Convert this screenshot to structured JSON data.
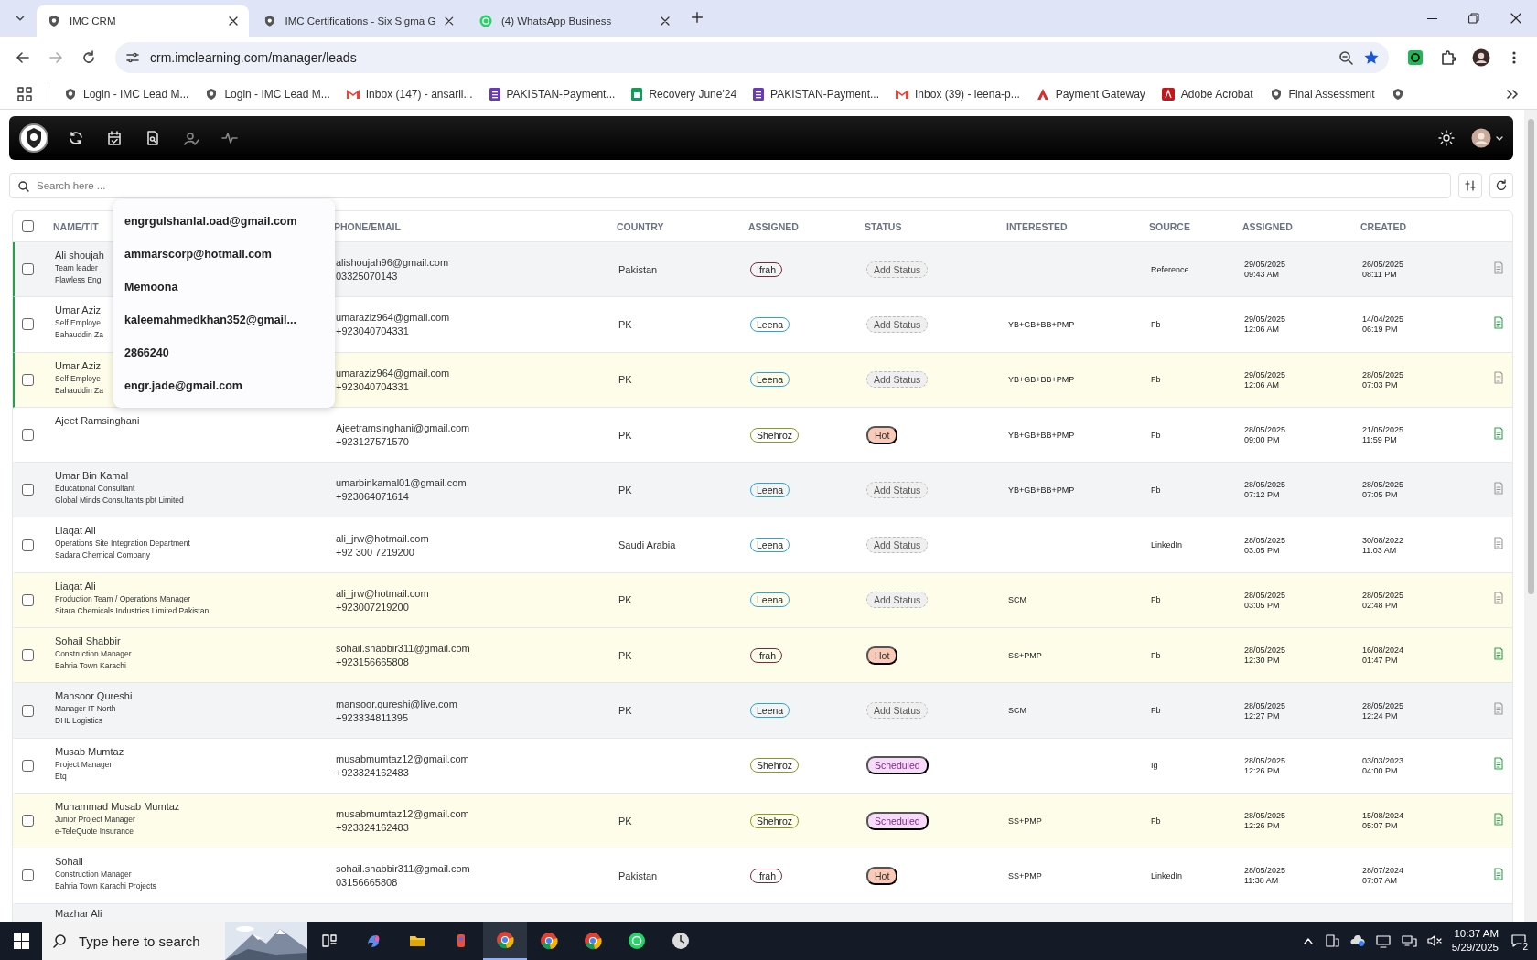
{
  "browser": {
    "tabs": [
      {
        "title": "IMC CRM",
        "kind": "imc",
        "selected": true
      },
      {
        "title": "IMC Certifications - Six Sigma G",
        "kind": "imc",
        "selected": false
      },
      {
        "title": "(4) WhatsApp Business",
        "kind": "whatsapp",
        "selected": false
      }
    ],
    "url": "crm.imclearning.com/manager/leads",
    "bookmarks": [
      {
        "label": "Login - IMC Lead M...",
        "kind": "imc"
      },
      {
        "label": "Login - IMC Lead M...",
        "kind": "imc"
      },
      {
        "label": "Inbox (147) - ansaril...",
        "kind": "gmail"
      },
      {
        "label": "PAKISTAN-Payment...",
        "kind": "form"
      },
      {
        "label": "Recovery June'24",
        "kind": "sheet"
      },
      {
        "label": "PAKISTAN-Payment...",
        "kind": "form"
      },
      {
        "label": "Inbox (39) - leena-p...",
        "kind": "gmail"
      },
      {
        "label": "Payment Gateway",
        "kind": "gateway"
      },
      {
        "label": "Adobe Acrobat",
        "kind": "acrobat"
      },
      {
        "label": "Final Assessment",
        "kind": "imc"
      },
      {
        "kind": "imc"
      }
    ]
  },
  "search": {
    "placeholder": "Search here ..."
  },
  "suggestions": [
    "engrgulshanlal.oad@gmail.com",
    "ammarscorp@hotmail.com",
    "Memoona",
    "kaleemahmedkhan352@gmail...",
    "2866240",
    "engr.jade@gmail.com"
  ],
  "table": {
    "select_all": {
      "checked": false
    },
    "columns": [
      "NAME/TIT",
      "PHONE/EMAIL",
      "COUNTRY",
      "ASSIGNED",
      "STATUS",
      "INTERESTED",
      "SOURCE",
      "ASSIGNED",
      "CREATED"
    ],
    "rows": [
      {
        "checked": false,
        "name": "Ali shoujah",
        "title": "Team leader",
        "company": "Flawless Engi",
        "email": "alishoujah96@gmail.com",
        "phone": "03325070143",
        "country": "Pakistan",
        "assignee": {
          "name": "Ifrah",
          "color": "#7a2a3a"
        },
        "status": {
          "kind": "empty",
          "label": "Add Status"
        },
        "source": "Reference",
        "assigned_date": "29/05/2025",
        "assigned_time": "09:43 AM",
        "created_date": "26/05/2025",
        "created_time": "08:11 PM",
        "color": "#f3f4f6",
        "flagged": true,
        "has_notes": false
      },
      {
        "checked": false,
        "name": "Umar Aziz",
        "title": "Self Employe",
        "company": "Bahauddin Za",
        "email": "umaraziz964@gmail.com",
        "phone": "+923040704331",
        "country": "PK",
        "assignee": {
          "name": "Leena",
          "color": "#2aa6d6"
        },
        "status": {
          "kind": "empty",
          "label": "Add Status"
        },
        "interested": "YB+GB+BB+PMP",
        "source": "Fb",
        "assigned_date": "29/05/2025",
        "assigned_time": "12:06 AM",
        "created_date": "14/04/2025",
        "created_time": "06:19 PM",
        "color": "#ffffff",
        "flagged": true,
        "has_notes": true
      },
      {
        "checked": false,
        "name": "Umar Aziz",
        "title": "Self Employe",
        "company": "Bahauddin Za",
        "email": "umaraziz964@gmail.com",
        "phone": "+923040704331",
        "country": "PK",
        "assignee": {
          "name": "Leena",
          "color": "#2aa6d6"
        },
        "status": {
          "kind": "empty",
          "label": "Add Status"
        },
        "interested": "YB+GB+BB+PMP",
        "source": "Fb",
        "assigned_date": "29/05/2025",
        "assigned_time": "12:06 AM",
        "created_date": "28/05/2025",
        "created_time": "07:03 PM",
        "color": "#fdfde9",
        "flagged": true,
        "has_notes": false
      },
      {
        "checked": false,
        "name": "Ajeet Ramsinghani",
        "email": "Ajeetramsinghani@gmail.com",
        "phone": "+923127571570",
        "country": "PK",
        "assignee": {
          "name": "Shehroz",
          "color": "#8a9a1a"
        },
        "status": {
          "kind": "hot",
          "label": "Hot"
        },
        "interested": "YB+GB+BB+PMP",
        "source": "Fb",
        "assigned_date": "28/05/2025",
        "assigned_time": "09:00 PM",
        "created_date": "21/05/2025",
        "created_time": "11:59 PM",
        "color": "#ffffff",
        "flagged": false,
        "has_notes": true
      },
      {
        "checked": false,
        "name": "Umar Bin Kamal",
        "title": "Educational Consultant",
        "company": "Global Minds Consultants pbt Limited",
        "email": "umarbinkamal01@gmail.com",
        "phone": "+923064071614",
        "country": "PK",
        "assignee": {
          "name": "Leena",
          "color": "#2aa6d6"
        },
        "status": {
          "kind": "empty",
          "label": "Add Status"
        },
        "interested": "YB+GB+BB+PMP",
        "source": "Fb",
        "assigned_date": "28/05/2025",
        "assigned_time": "07:12 PM",
        "created_date": "28/05/2025",
        "created_time": "07:05 PM",
        "color": "#f3f4f6",
        "flagged": false,
        "has_notes": false
      },
      {
        "checked": false,
        "name": "Liaqat Ali",
        "title": "Operations Site Integration Department",
        "company": "Sadara Chemical Company",
        "email": "ali_jrw@hotmail.com",
        "phone": "+92 300 7219200",
        "country": "Saudi Arabia",
        "assignee": {
          "name": "Leena",
          "color": "#2aa6d6"
        },
        "status": {
          "kind": "empty",
          "label": "Add Status"
        },
        "source": "LinkedIn",
        "assigned_date": "28/05/2025",
        "assigned_time": "03:05 PM",
        "created_date": "30/08/2022",
        "created_time": "11:03 AM",
        "color": "#ffffff",
        "flagged": false,
        "has_notes": false
      },
      {
        "checked": false,
        "name": "Liaqat Ali",
        "title": "Production Team / Operations Manager",
        "company": "Sitara Chemicals Industries Limited Pakistan",
        "email": "ali_jrw@hotmail.com",
        "phone": "+923007219200",
        "country": "PK",
        "assignee": {
          "name": "Leena",
          "color": "#2aa6d6"
        },
        "status": {
          "kind": "empty",
          "label": "Add Status"
        },
        "interested": "SCM",
        "source": "Fb",
        "assigned_date": "28/05/2025",
        "assigned_time": "03:05 PM",
        "created_date": "28/05/2025",
        "created_time": "02:48 PM",
        "color": "#fdfde9",
        "flagged": false,
        "has_notes": false
      },
      {
        "checked": false,
        "name": "Sohail Shabbir",
        "title": "Construction Manager",
        "company": "Bahria Town Karachi",
        "email": "sohail.shabbir311@gmail.com",
        "phone": "+923156665808",
        "country": "PK",
        "assignee": {
          "name": "Ifrah",
          "color": "#7a2a3a"
        },
        "status": {
          "kind": "hot",
          "label": "Hot"
        },
        "interested": "SS+PMP",
        "source": "Fb",
        "assigned_date": "28/05/2025",
        "assigned_time": "12:30 PM",
        "created_date": "16/08/2024",
        "created_time": "01:47 PM",
        "color": "#fdfde9",
        "flagged": false,
        "has_notes": true
      },
      {
        "checked": false,
        "name": "Mansoor Qureshi",
        "title": "Manager IT North",
        "company": "DHL Logistics",
        "email": "mansoor.qureshi@live.com",
        "phone": "+923334811395",
        "country": "PK",
        "assignee": {
          "name": "Leena",
          "color": "#2aa6d6"
        },
        "status": {
          "kind": "empty",
          "label": "Add Status"
        },
        "interested": "SCM",
        "source": "Fb",
        "assigned_date": "28/05/2025",
        "assigned_time": "12:27 PM",
        "created_date": "28/05/2025",
        "created_time": "12:24 PM",
        "color": "#f3f4f6",
        "flagged": false,
        "has_notes": false
      },
      {
        "checked": false,
        "name": "Musab Mumtaz",
        "title": "Project Manager",
        "company": "Etq",
        "email": "musabmumtaz12@gmail.com",
        "phone": "+923324162483",
        "assignee": {
          "name": "Shehroz",
          "color": "#8a9a1a"
        },
        "status": {
          "kind": "scheduled",
          "label": "Scheduled"
        },
        "source": "Ig",
        "assigned_date": "28/05/2025",
        "assigned_time": "12:26 PM",
        "created_date": "03/03/2023",
        "created_time": "04:00 PM",
        "color": "#ffffff",
        "flagged": false,
        "has_notes": true
      },
      {
        "checked": false,
        "name": "Muhammad Musab Mumtaz",
        "title": "Junior Project Manager",
        "company": "e-TeleQuote Insurance",
        "email": "musabmumtaz12@gmail.com",
        "phone": "+923324162483",
        "country": "PK",
        "assignee": {
          "name": "Shehroz",
          "color": "#8a9a1a"
        },
        "status": {
          "kind": "scheduled",
          "label": "Scheduled"
        },
        "interested": "SS+PMP",
        "source": "Fb",
        "assigned_date": "28/05/2025",
        "assigned_time": "12:26 PM",
        "created_date": "15/08/2024",
        "created_time": "05:07 PM",
        "color": "#fdfde9",
        "flagged": false,
        "has_notes": true
      },
      {
        "checked": false,
        "name": "Sohail",
        "title": "Construction Manager",
        "company": "Bahria Town Karachi Projects",
        "email": "sohail.shabbir311@gmail.com",
        "phone": "03156665808",
        "country": "Pakistan",
        "assignee": {
          "name": "Ifrah",
          "color": "#7a2a3a"
        },
        "status": {
          "kind": "hot",
          "label": "Hot"
        },
        "interested": "SS+PMP",
        "source": "LinkedIn",
        "assigned_date": "28/05/2025",
        "assigned_time": "11:38 AM",
        "created_date": "28/07/2024",
        "created_time": "07:07 AM",
        "color": "#ffffff",
        "flagged": false,
        "has_notes": true
      }
    ],
    "partial_row": {
      "name": "Mazhar Ali",
      "color": "#f3f4f6"
    }
  },
  "taskbar": {
    "search_placeholder": "Type here to search",
    "time": "10:37 AM",
    "date": "5/29/2025",
    "notifications": "2"
  }
}
